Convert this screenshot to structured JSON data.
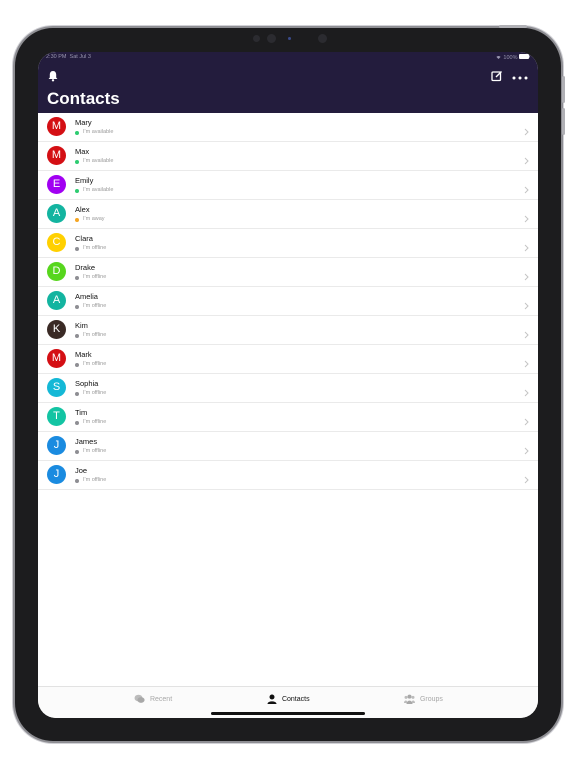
{
  "status_bar": {
    "time": "2:30 PM",
    "date": "Sat Jul 3",
    "battery": "100%"
  },
  "header": {
    "title": "Contacts",
    "accent": "#231c3d"
  },
  "contacts": [
    {
      "initial": "M",
      "name": "Mary",
      "status": "I'm available",
      "avatar_color": "#d40f14",
      "status_color": "#2ecc71"
    },
    {
      "initial": "M",
      "name": "Max",
      "status": "I'm available",
      "avatar_color": "#d40f14",
      "status_color": "#2ecc71"
    },
    {
      "initial": "E",
      "name": "Emily",
      "status": "I'm available",
      "avatar_color": "#a100f2",
      "status_color": "#2ecc71"
    },
    {
      "initial": "A",
      "name": "Alex",
      "status": "I'm away",
      "avatar_color": "#13b4a0",
      "status_color": "#f5a623"
    },
    {
      "initial": "C",
      "name": "Clara",
      "status": "I'm offline",
      "avatar_color": "#ffd000",
      "status_color": "#8e8e93"
    },
    {
      "initial": "D",
      "name": "Drake",
      "status": "I'm offline",
      "avatar_color": "#57d61d",
      "status_color": "#8e8e93"
    },
    {
      "initial": "A",
      "name": "Amelia",
      "status": "I'm offline",
      "avatar_color": "#13b4a0",
      "status_color": "#8e8e93"
    },
    {
      "initial": "K",
      "name": "Kim",
      "status": "I'm offline",
      "avatar_color": "#3a2a25",
      "status_color": "#8e8e93"
    },
    {
      "initial": "M",
      "name": "Mark",
      "status": "I'm offline",
      "avatar_color": "#d40f14",
      "status_color": "#8e8e93"
    },
    {
      "initial": "S",
      "name": "Sophia",
      "status": "I'm offline",
      "avatar_color": "#14b8d6",
      "status_color": "#8e8e93"
    },
    {
      "initial": "T",
      "name": "Tim",
      "status": "I'm offline",
      "avatar_color": "#13c4a3",
      "status_color": "#8e8e93"
    },
    {
      "initial": "J",
      "name": "James",
      "status": "I'm offline",
      "avatar_color": "#1a8be0",
      "status_color": "#8e8e93"
    },
    {
      "initial": "J",
      "name": "Joe",
      "status": "I'm offline",
      "avatar_color": "#1a8be0",
      "status_color": "#8e8e93"
    }
  ],
  "tabs": {
    "recent": "Recent",
    "contacts": "Contacts",
    "groups": "Groups",
    "selected": "contacts"
  },
  "icons": {
    "header_left": "bell-icon",
    "header_right": [
      "compose-icon",
      "more-icon"
    ],
    "row_accessory": "chevron-right-icon",
    "tab_recent": "chat-bubbles-icon",
    "tab_contacts": "person-icon",
    "tab_groups": "group-icon"
  }
}
